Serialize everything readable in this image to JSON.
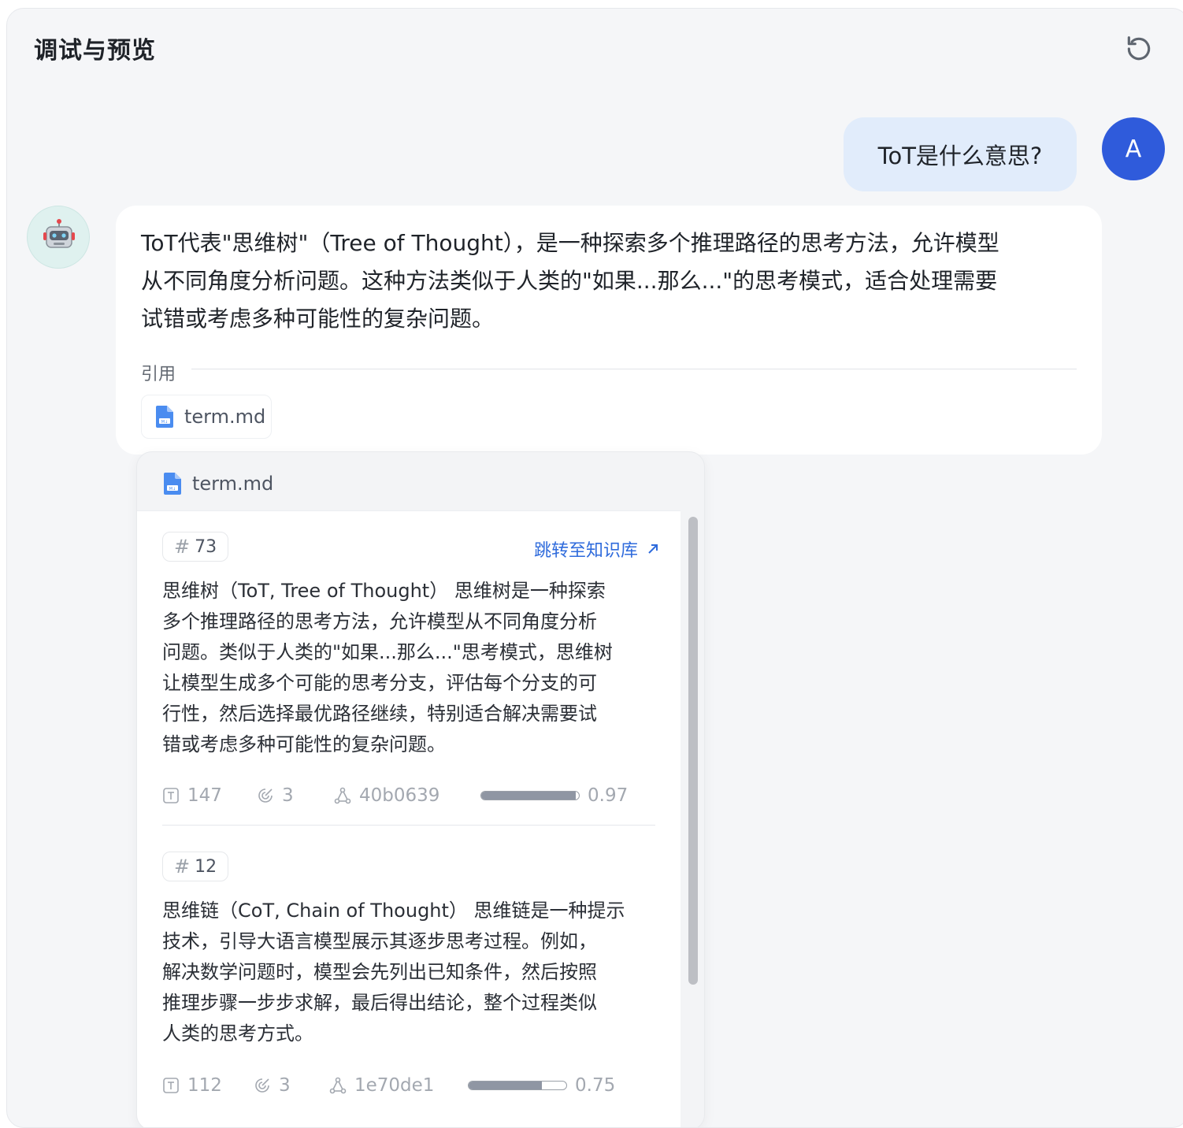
{
  "header": {
    "title": "调试与预览"
  },
  "user": {
    "question": "ToT是什么意思?",
    "avatar_initial": "A"
  },
  "bot": {
    "answer_lines": [
      "ToT代表\"思维树\"（Tree of Thought），是一种探索多个推理路径的思考方法，允许模型",
      "从不同角度分析问题。这种方法类似于人类的\"如果...那么...\"的思考模式，适合处理需要",
      "试错或考虑多种可能性的复杂问题。"
    ],
    "reference_label": "引用",
    "reference_file": "term.md"
  },
  "popover": {
    "file_name": "term.md",
    "jump_label": "跳转至知识库",
    "chunks": [
      {
        "id": "73",
        "text_lines": [
          "思维树（ToT, Tree of Thought） 思维树是一种探索",
          "多个推理路径的思考方法，允许模型从不同角度分析",
          "问题。类似于人类的\"如果...那么...\"思考模式，思维树",
          "让模型生成多个可能的思考分支，评估每个分支的可",
          "行性，然后选择最优路径继续，特别适合解决需要试",
          "错或考虑多种可能性的复杂问题。"
        ],
        "tokens": "147",
        "hits": "3",
        "hash": "40b0639",
        "score": 0.97,
        "score_label": "0.97"
      },
      {
        "id": "12",
        "text_lines": [
          "思维链（CoT, Chain of Thought） 思维链是一种提示",
          "技术，引导大语言模型展示其逐步思考过程。例如，",
          "解决数学问题时，模型会先列出已知条件，然后按照",
          "推理步骤一步步求解，最后得出结论，整个过程类似",
          "人类的思考方式。"
        ],
        "tokens": "112",
        "hits": "3",
        "hash": "1e70de1",
        "score": 0.75,
        "score_label": "0.75"
      }
    ]
  },
  "colors": {
    "accent": "#2f5bdb",
    "link": "#2f6bdc",
    "user_bubble": "#e1ecfb",
    "panel_bg": "#f5f6f8"
  }
}
